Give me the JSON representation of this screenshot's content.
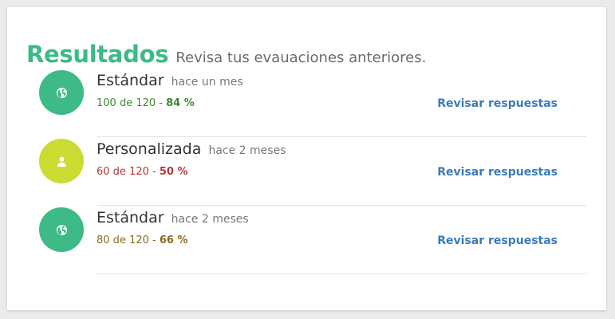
{
  "header": {
    "title": "Resultados",
    "subtitle": "Revisa tus evauaciones anteriores."
  },
  "results": [
    {
      "name": "Estándar",
      "time": "hace un mes",
      "score_text": "100 de 120 - ",
      "percent_text": "84 %",
      "percent": 84,
      "link": "Revisar respuestas",
      "icon": "globe-icon",
      "icon_color": "#3dba85",
      "score_color": "#3a8a2c"
    },
    {
      "name": "Personalizada",
      "time": "hace 2 meses",
      "score_text": "60 de 120 - ",
      "percent_text": "50 %",
      "percent": 50,
      "link": "Revisar respuestas",
      "icon": "user-icon",
      "icon_color": "#cbdb32",
      "score_color": "#b03a3a"
    },
    {
      "name": "Estándar",
      "time": "hace 2 meses",
      "score_text": "80 de 120 - ",
      "percent_text": "66 %",
      "percent": 66,
      "link": "Revisar respuestas",
      "icon": "globe-icon",
      "icon_color": "#3dba85",
      "score_color": "#8a6a22"
    }
  ]
}
